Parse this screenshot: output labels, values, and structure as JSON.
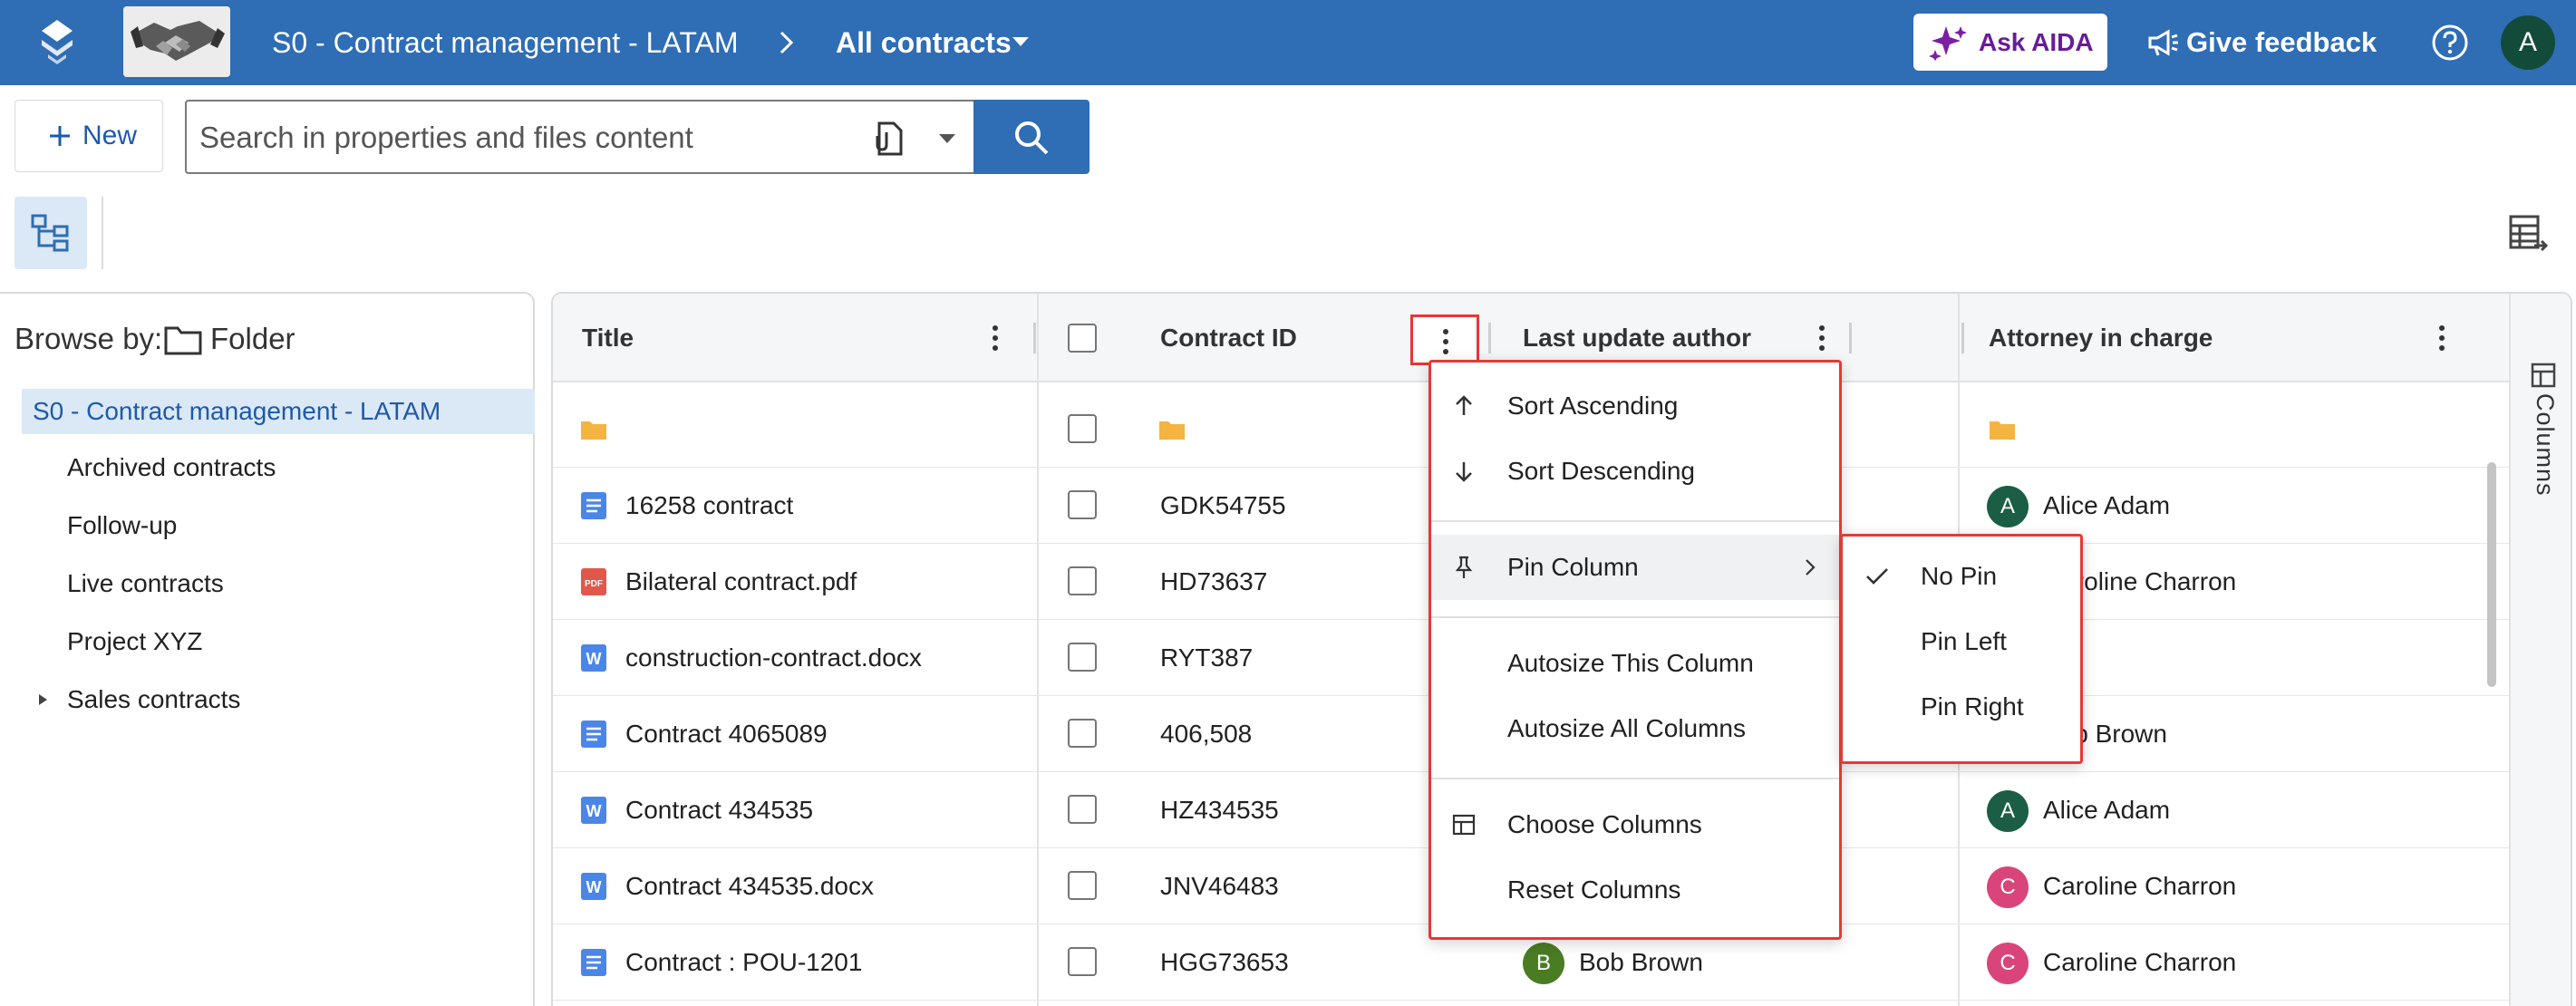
{
  "topbar": {
    "workspace_title": "S0 - Contract management - LATAM",
    "view_label": "All contracts",
    "ask_label": "Ask AIDA",
    "feedback_label": "Give feedback",
    "user_initial": "A",
    "bg_color": "#2f6db5"
  },
  "actions": {
    "new_label": "New",
    "search_placeholder": "Search in properties and files content"
  },
  "browse": {
    "label": "Browse by:",
    "mode": "Folder",
    "items": [
      {
        "label": "S0 - Contract management - LATAM",
        "selected": true
      },
      {
        "label": "Archived contracts"
      },
      {
        "label": "Follow-up"
      },
      {
        "label": "Live contracts"
      },
      {
        "label": "Project XYZ"
      },
      {
        "label": "Sales contracts",
        "expandable": true
      }
    ]
  },
  "grid": {
    "columns": [
      "Title",
      "Contract ID",
      "Last update author",
      "Attorney in charge"
    ],
    "side_tab": "Columns",
    "rows": [
      {
        "title": "",
        "icon": "folder-icon",
        "id": "",
        "author": "",
        "attorney": "",
        "attorney_initial": ""
      },
      {
        "title": "16258 contract",
        "icon": "doc-icon",
        "id": "GDK54755",
        "author": "",
        "attorney": "Alice Adam",
        "attorney_initial": "A",
        "attorney_color": "#1b5e45"
      },
      {
        "title": "Bilateral contract.pdf",
        "icon": "pdf-icon",
        "id": "HD73637",
        "author": "",
        "attorney": "Caroline Charron",
        "attorney_initial": "C",
        "attorney_color": "#d9457a"
      },
      {
        "title": "construction-contract.docx",
        "icon": "word-icon",
        "id": "RYT387",
        "author": "",
        "attorney": "",
        "attorney_initial": ""
      },
      {
        "title": "Contract 4065089",
        "icon": "doc-icon",
        "id": "406,508",
        "author": "",
        "attorney": "Bob Brown",
        "attorney_initial": "B",
        "attorney_color": "#4a7c23"
      },
      {
        "title": "Contract 434535",
        "icon": "word-icon",
        "id": "HZ434535",
        "author": "",
        "attorney": "Alice Adam",
        "attorney_initial": "A",
        "attorney_color": "#1b5e45"
      },
      {
        "title": "Contract 434535.docx",
        "icon": "word-icon",
        "id": "JNV46483",
        "author": "",
        "attorney": "Caroline Charron",
        "attorney_initial": "C",
        "attorney_color": "#d9457a"
      },
      {
        "title": "Contract : POU-1201",
        "icon": "doc-icon",
        "id": "HGG73653",
        "author": "Bob Brown",
        "author_initial": "B",
        "author_color": "#4a7c23",
        "attorney": "Caroline Charron",
        "attorney_initial": "C",
        "attorney_color": "#d9457a"
      }
    ]
  },
  "column_menu": {
    "sort_asc": "Sort Ascending",
    "sort_desc": "Sort Descending",
    "pin_column": "Pin Column",
    "autosize_this": "Autosize This Column",
    "autosize_all": "Autosize All Columns",
    "choose_columns": "Choose Columns",
    "reset_columns": "Reset Columns"
  },
  "pin_menu": {
    "no_pin": "No Pin",
    "pin_left": "Pin Left",
    "pin_right": "Pin Right",
    "selected": "No Pin"
  },
  "colors": {
    "accent": "#2f6db5",
    "highlight": "#e53935",
    "folder": "#f4b43f",
    "doc": "#4a86e8",
    "pdf": "#e2574c",
    "word": "#4a86e8"
  }
}
